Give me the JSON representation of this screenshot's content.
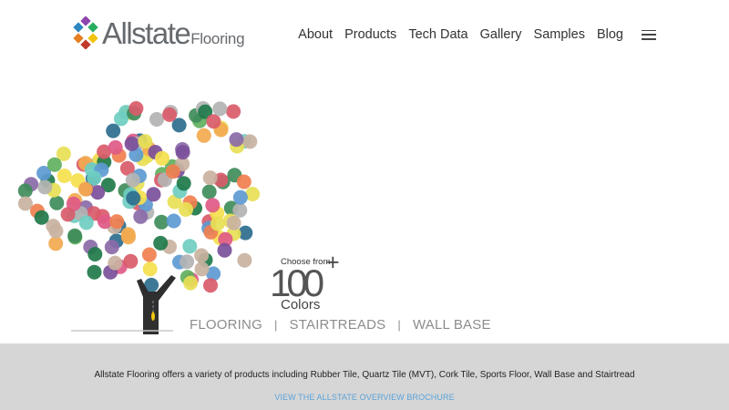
{
  "header": {
    "logo": {
      "brand": "Allstate",
      "sub": "Flooring"
    },
    "nav": [
      "About",
      "Products",
      "Tech Data",
      "Gallery",
      "Samples",
      "Blog"
    ],
    "menu_icon": "hamburger-icon"
  },
  "hero": {
    "callout": {
      "small": "Choose from",
      "big": "100",
      "plus": "+",
      "label": "Colors"
    },
    "categories": [
      "FLOORING",
      "STAIRTREADS",
      "WALL BASE"
    ],
    "separator": "|"
  },
  "footer": {
    "text": "Allstate Flooring offers a variety of products including Rubber Tile, Quartz Tile (MVT), Cork Tile, Sports Floor, Wall Base and Stairtread",
    "link": "VIEW THE ALLSTATE OVERVIEW BROCHURE"
  },
  "colors": {
    "footer_band": "#d6d6d6",
    "link": "#5aa3da",
    "palette": [
      "#e8e055",
      "#d95b6a",
      "#8b6aa8",
      "#5d9ad3",
      "#61b05e",
      "#f2a94f",
      "#b3b3b3",
      "#3f8c5a",
      "#f5e04d",
      "#e05a87",
      "#2d6e8e",
      "#c9b2a0",
      "#7b4f9a",
      "#f07f4f",
      "#6fcdc1",
      "#1f7a4a"
    ]
  }
}
